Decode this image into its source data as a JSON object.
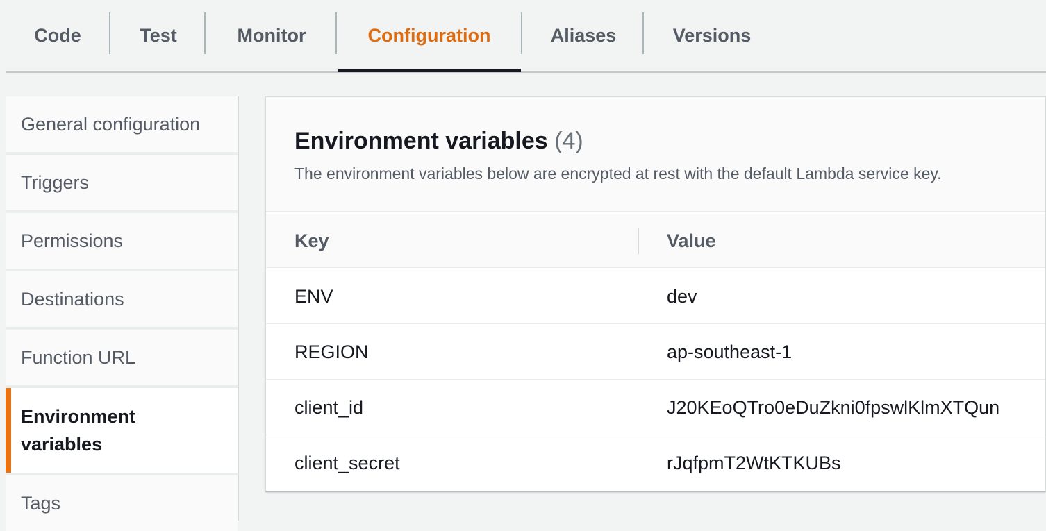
{
  "tabs": [
    {
      "label": "Code"
    },
    {
      "label": "Test"
    },
    {
      "label": "Monitor"
    },
    {
      "label": "Configuration",
      "active": true
    },
    {
      "label": "Aliases"
    },
    {
      "label": "Versions"
    }
  ],
  "sidebar": {
    "items": [
      {
        "label": "General configuration"
      },
      {
        "label": "Triggers"
      },
      {
        "label": "Permissions"
      },
      {
        "label": "Destinations"
      },
      {
        "label": "Function URL"
      },
      {
        "label": "Environment variables",
        "active": true
      },
      {
        "label": "Tags"
      }
    ]
  },
  "panel": {
    "title": "Environment variables",
    "count": "(4)",
    "description": "The environment variables below are encrypted at rest with the default Lambda service key.",
    "columns": {
      "key": "Key",
      "value": "Value"
    },
    "rows": [
      {
        "key": "ENV",
        "value": "dev"
      },
      {
        "key": "REGION",
        "value": "ap-southeast-1"
      },
      {
        "key": "client_id",
        "value": "J20KEoQTro0eDuZkni0fpswlKlmXTQun"
      },
      {
        "key": "client_secret",
        "value": "rJqfpmT2WtKTKUBs"
      }
    ]
  },
  "colors": {
    "accent": "#dd6b10",
    "active_indicator": "#ec7211",
    "text": "#16191f",
    "muted_text": "#545b64",
    "background": "#f2f3f3"
  }
}
